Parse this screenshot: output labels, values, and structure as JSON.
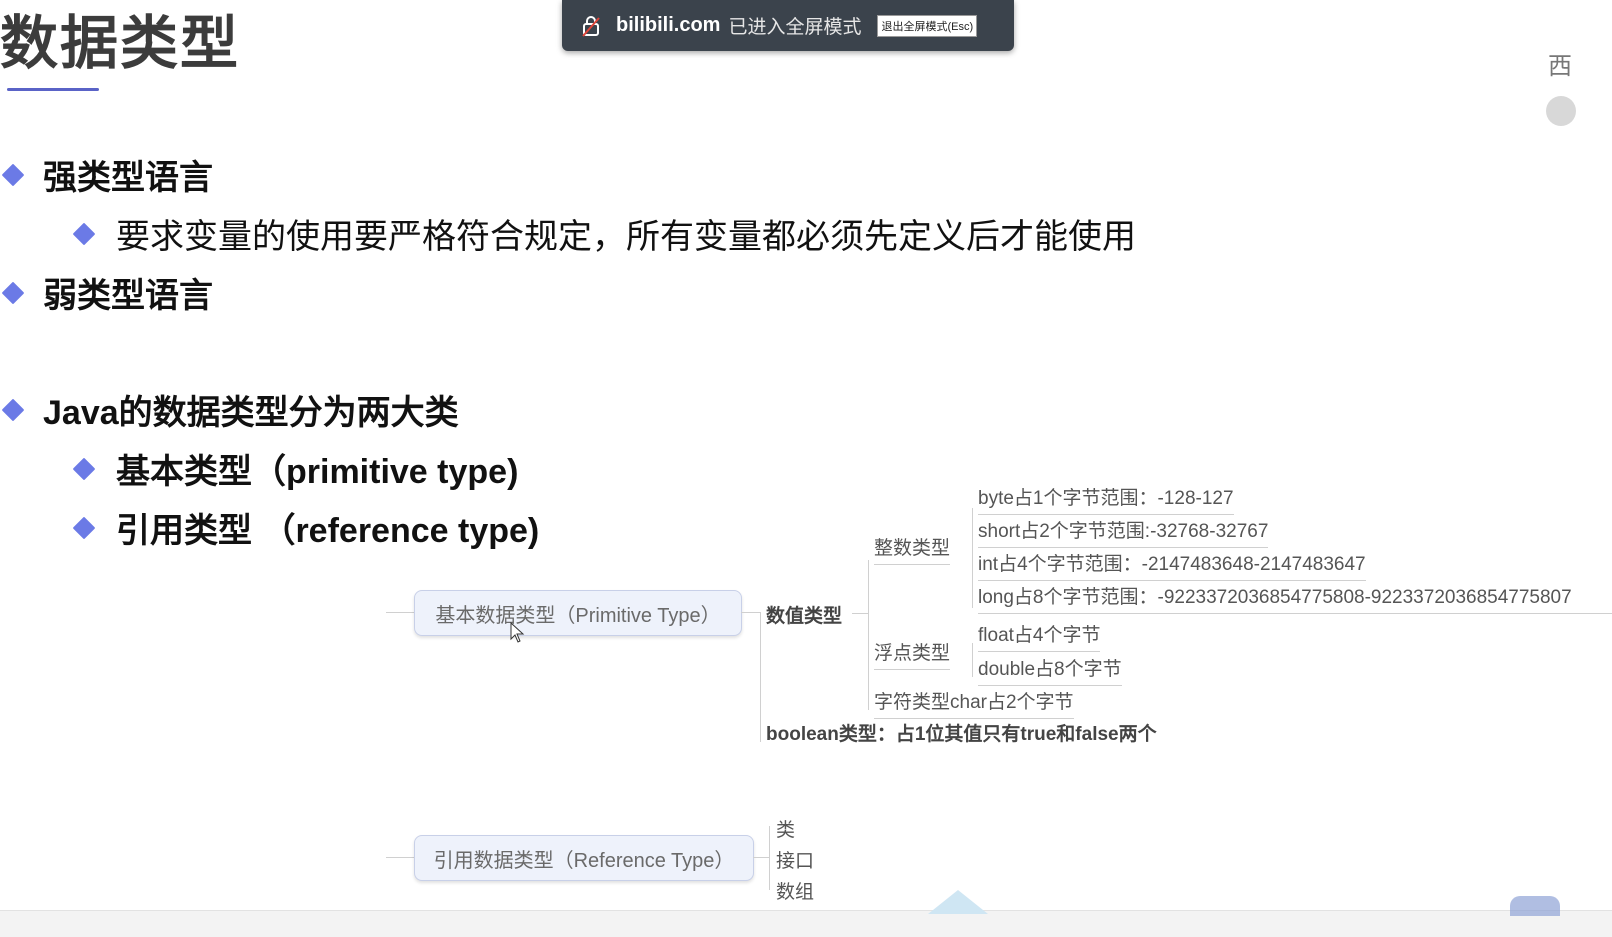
{
  "slide": {
    "title": "数据类型",
    "bullets": {
      "strong": "强类型语言",
      "strong_sub": "要求变量的使用要严格符合规定，所有变量都必须先定义后才能使用",
      "weak": "弱类型语言",
      "java": "Java的数据类型分为两大类",
      "primitive": "基本类型（primitive type)",
      "reference": "引用类型 （reference type)"
    }
  },
  "mindmap": {
    "primitive_root": "基本数据类型（Primitive Type）",
    "numeric": "数值类型",
    "integer": "整数类型",
    "byte": "byte占1个字节范围：-128-127",
    "short": "short占2个字节范围:-32768-32767",
    "int": "int占4个字节范围：-2147483648-2147483647",
    "long": "long占8个字节范围：-9223372036854775808-9223372036854775807",
    "float_group": "浮点类型",
    "float": "float占4个字节",
    "double": "double占8个字节",
    "char": "字符类型char占2个字节",
    "boolean": "boolean类型：占1位其值只有true和false两个",
    "reference_root": "引用数据类型（Reference Type）",
    "ref_class": "类",
    "ref_interface": "接口",
    "ref_array": "数组"
  },
  "fullscreen_toast": {
    "site": "bilibili.com",
    "message": "已进入全屏模式",
    "exit_label": "退出全屏模式(Esc)"
  },
  "edge": {
    "char": "西"
  },
  "colors": {
    "bullet": "#6b7ae6",
    "title_underline": "#5a63c7",
    "toast_bg": "#3b434c",
    "mindmap_box_bg": "#eef2fb"
  },
  "icons": {
    "toast_lock": "lock-icon",
    "bullet": "diamond-bullet-icon",
    "cursor": "mouse-pointer-icon"
  }
}
